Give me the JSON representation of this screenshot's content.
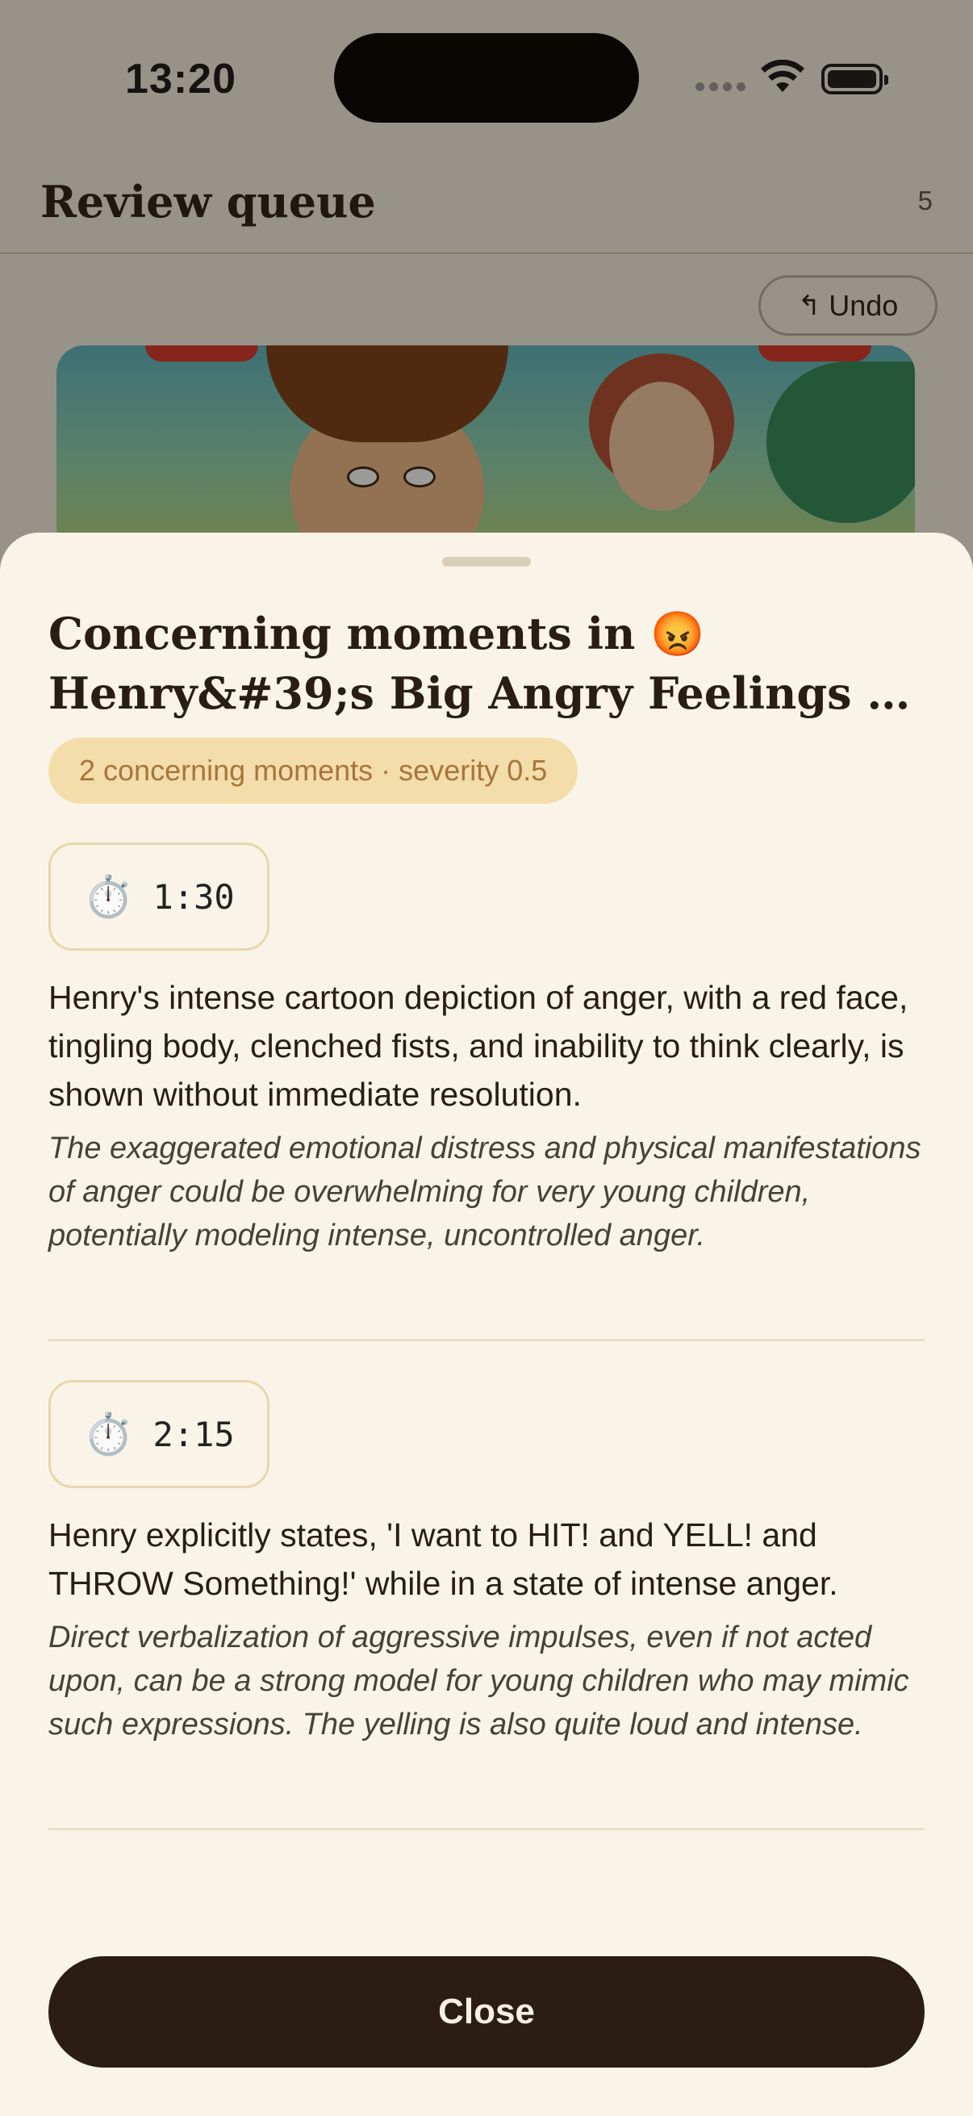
{
  "status_bar": {
    "time": "13:20"
  },
  "nav": {
    "title": "Review queue",
    "count": "5"
  },
  "undo": {
    "icon": "↰",
    "label": "Undo"
  },
  "sheet": {
    "title": "Concerning moments in 😡Henry&#39;s Big Angry Feelings - Anger Management...",
    "badge": "2 concerning moments · severity 0.5",
    "moments": [
      {
        "icon": "⏱️",
        "time": "1:30",
        "description": "Henry's intense cartoon depiction of anger, with a red face, tingling body, clenched fists, and inability to think clearly, is shown without immediate resolution.",
        "note": "The exaggerated emotional distress and physical manifestations of anger could be overwhelming for very young children, potentially modeling intense, uncontrolled anger."
      },
      {
        "icon": "⏱️",
        "time": "2:15",
        "description": "Henry explicitly states, 'I want to HIT! and YELL! and THROW Something!' while in a state of intense anger.",
        "note": "Direct verbalization of aggressive impulses, even if not acted upon, can be a strong model for young children who may mimic such expressions. The yelling is also quite loud and intense."
      }
    ],
    "close_label": "Close"
  },
  "colors": {
    "sheet_bg": "#faf4e8",
    "badge_bg": "#f3ddaa",
    "badge_text": "#a8753b",
    "button_bg": "#2b1d14",
    "text": "#2a1d12"
  }
}
